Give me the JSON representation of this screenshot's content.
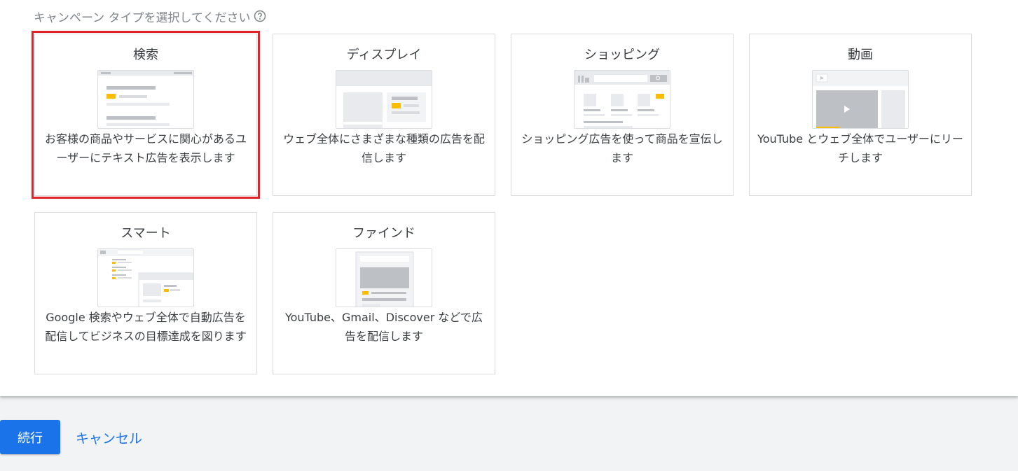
{
  "heading": {
    "text": "キャンペーン タイプを選択してください",
    "help_icon": "help-circle-icon"
  },
  "cards": [
    {
      "title": "検索",
      "description": "お客様の商品やサービスに関心があるユーザーにテキスト広告を表示します",
      "selected": true
    },
    {
      "title": "ディスプレイ",
      "description": "ウェブ全体にさまざまな種類の広告を配信します",
      "selected": false
    },
    {
      "title": "ショッピング",
      "description": "ショッピング広告を使って商品を宣伝します",
      "selected": false
    },
    {
      "title": "動画",
      "description": "YouTube とウェブ全体でユーザーにリーチします",
      "selected": false
    },
    {
      "title": "スマート",
      "description": "Google 検索やウェブ全体で自動広告を配信してビジネスの目標達成を図ります",
      "selected": false
    },
    {
      "title": "ファインド",
      "description": "YouTube、Gmail、Discover などで広告を配信します",
      "selected": false
    }
  ],
  "footer": {
    "continue_label": "続行",
    "cancel_label": "キャンセル"
  },
  "colors": {
    "accent": "#1a73e8",
    "selection": "#e32128",
    "highlight": "#fbbc04"
  }
}
